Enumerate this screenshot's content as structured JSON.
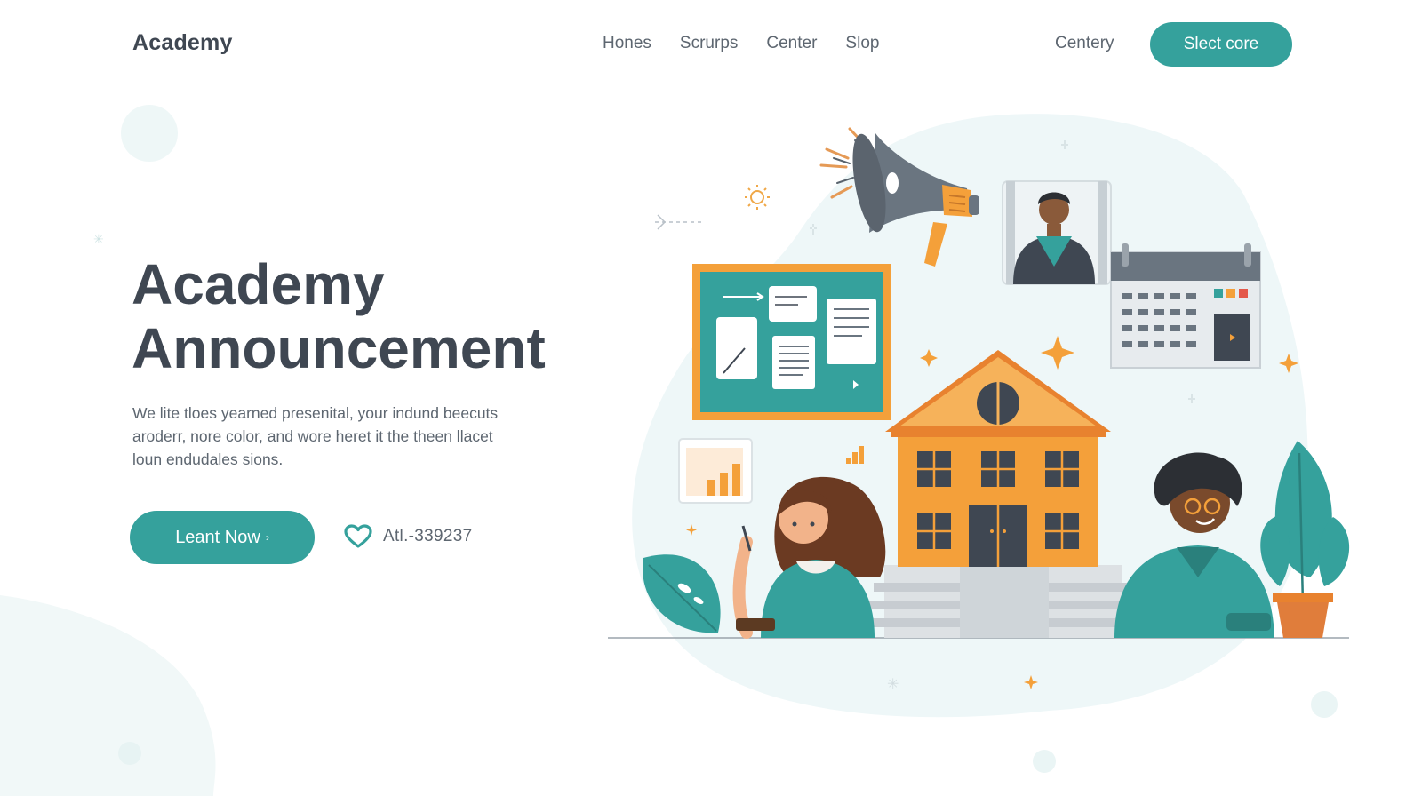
{
  "header": {
    "logo": "Academy",
    "nav": [
      "Hones",
      "Scrurps",
      "Center",
      "Slop"
    ],
    "secondary_link": "Centery",
    "cta_label": "Slect core"
  },
  "hero": {
    "title_line1": "Academy",
    "title_line2": "Announcement",
    "description": "We lite tloes yearned presenital, your indund beecuts aroderr, nore color, and wore heret it the theen llacet loun endudales sions.",
    "button_label": "Leant Now",
    "button_chevron": "›",
    "contact_icon": "heart-icon",
    "contact_text": "Atl.-339237"
  },
  "colors": {
    "accent": "#35a19c",
    "orange": "#f4a03a",
    "text_dark": "#3f4752",
    "text_muted": "#5d6670"
  }
}
